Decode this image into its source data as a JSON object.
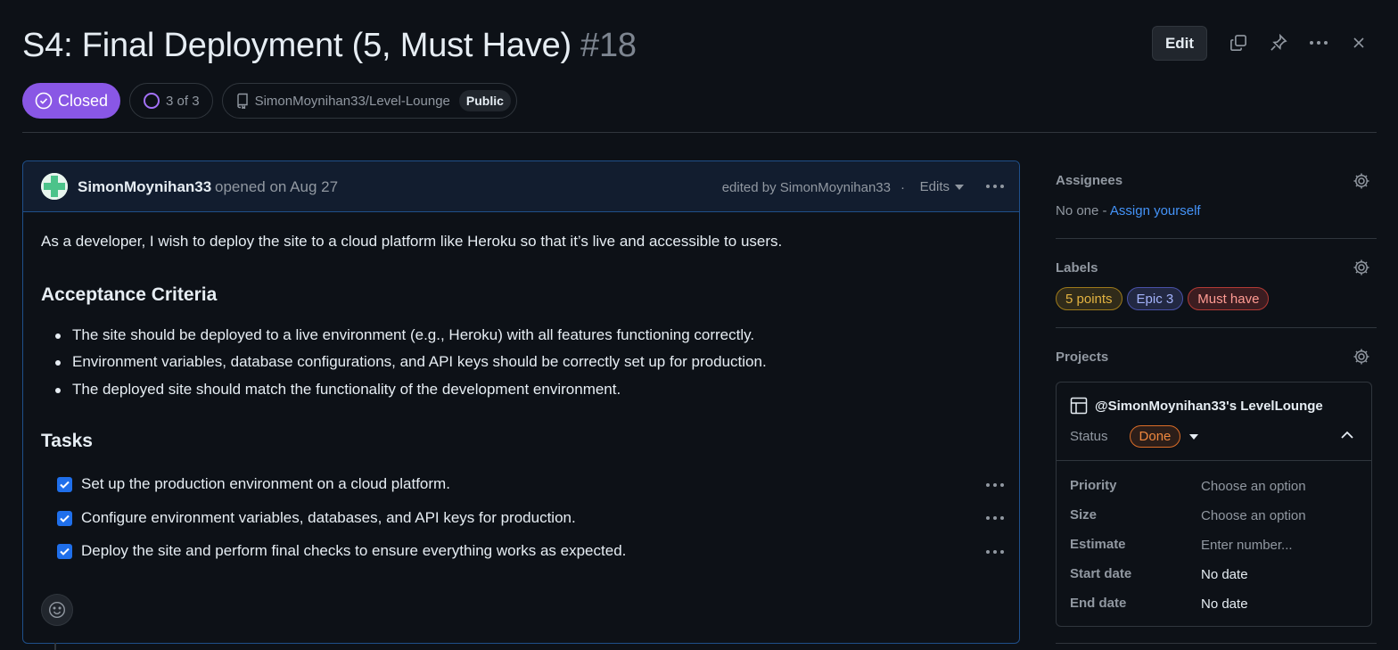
{
  "issue": {
    "title": "S4: Final Deployment (5, Must Have)",
    "number": "#18",
    "state": "Closed",
    "subissues": "3 of 3",
    "repo": "SimonMoynihan33/Level-Lounge",
    "visibility": "Public"
  },
  "header": {
    "edit_label": "Edit"
  },
  "comment": {
    "author": "SimonMoynihan33",
    "opened_text": "opened on Aug 27",
    "edited_text": "edited by SimonMoynihan33",
    "separator": "·",
    "edits_label": "Edits",
    "body": "As a developer, I wish to deploy the site to a cloud platform like Heroku so that it’s live and accessible to users.",
    "criteria_heading": "Acceptance Criteria",
    "criteria": [
      "The site should be deployed to a live environment (e.g., Heroku) with all features functioning correctly.",
      "Environment variables, database configurations, and API keys should be correctly set up for production.",
      "The deployed site should match the functionality of the development environment."
    ],
    "tasks_heading": "Tasks",
    "tasks": [
      {
        "label": "Set up the production environment on a cloud platform.",
        "checked": true
      },
      {
        "label": "Configure environment variables, databases, and API keys for production.",
        "checked": true
      },
      {
        "label": "Deploy the site and perform final checks to ensure everything works as expected.",
        "checked": true
      }
    ]
  },
  "sidebar": {
    "assignees": {
      "title": "Assignees",
      "none": "No one -",
      "assign_self": "Assign yourself"
    },
    "labels": {
      "title": "Labels",
      "items": [
        {
          "name": "5 points",
          "color": "#d4a72c"
        },
        {
          "name": "Epic 3",
          "color": "#6e7ce0"
        },
        {
          "name": "Must have",
          "color": "#f85149"
        }
      ]
    },
    "projects": {
      "title": "Projects",
      "project_name": "@SimonMoynihan33's LevelLounge",
      "status_key": "Status",
      "status_value": "Done",
      "fields": [
        {
          "key": "Priority",
          "value": "Choose an option"
        },
        {
          "key": "Size",
          "value": "Choose an option"
        },
        {
          "key": "Estimate",
          "value": "Enter number..."
        },
        {
          "key": "Start date",
          "value": "No date"
        },
        {
          "key": "End date",
          "value": "No date"
        }
      ]
    }
  },
  "colors": {
    "background": "#0d1117",
    "closed_badge": "#8957e5",
    "link": "#4493f8",
    "checkbox": "#1f6feb"
  }
}
